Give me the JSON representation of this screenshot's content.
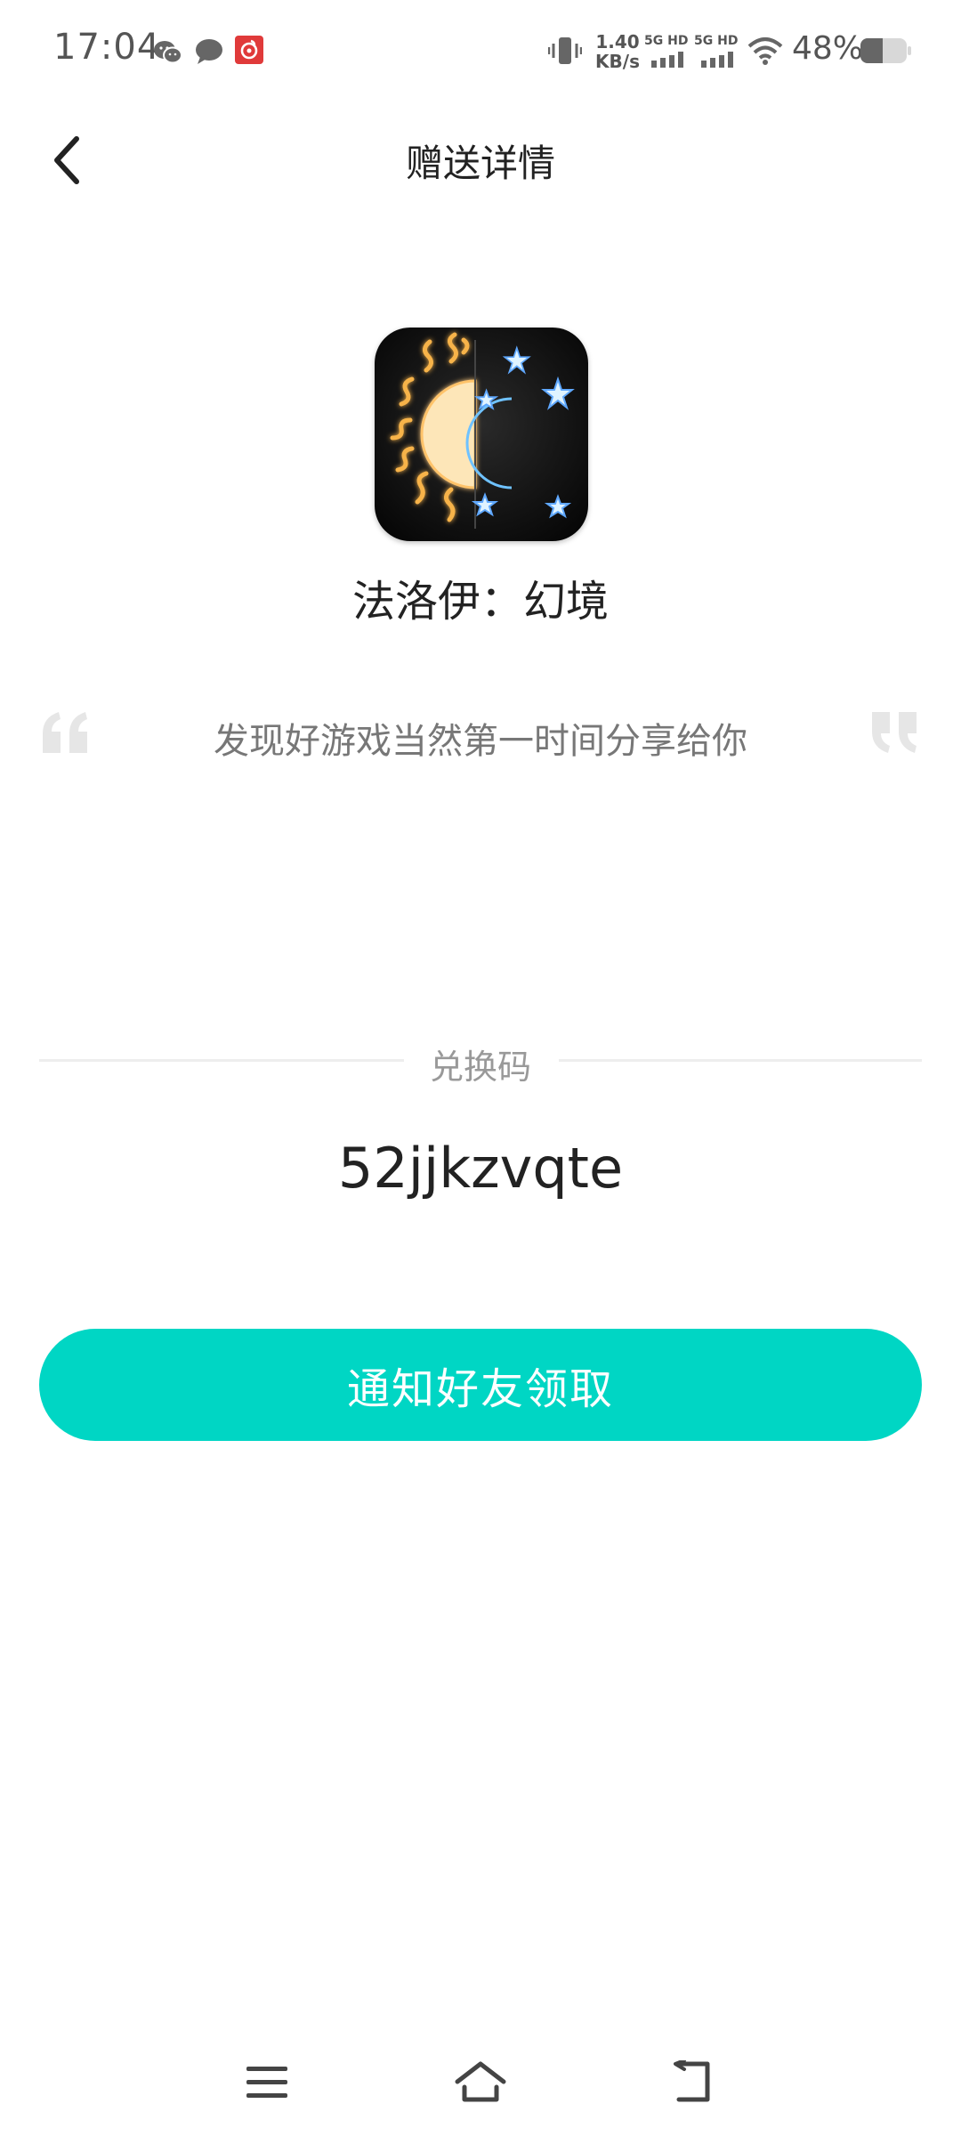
{
  "status_bar": {
    "time": "17:04",
    "net_speed_value": "1.40",
    "net_speed_unit": "KB/s",
    "sim1_label": "5G HD",
    "sim2_label": "5G HD",
    "battery_percent": "48%",
    "icons": [
      "wechat-icon",
      "message-icon",
      "netease-music-icon",
      "vibrate-icon",
      "wifi-icon",
      "battery-icon"
    ]
  },
  "header": {
    "title": "赠送详情",
    "back_icon": "chevron-left-icon"
  },
  "game": {
    "name": "法洛伊：幻境",
    "icon": "sun-moon-icon"
  },
  "quote": {
    "text": "发现好游戏当然第一时间分享给你"
  },
  "redeem": {
    "label": "兑换码",
    "code": "52jjkzvqte"
  },
  "action": {
    "notify_label": "通知好友领取",
    "color": "#00d6c4"
  },
  "nav": {
    "icons": [
      "menu-icon",
      "home-icon",
      "back-icon"
    ]
  }
}
